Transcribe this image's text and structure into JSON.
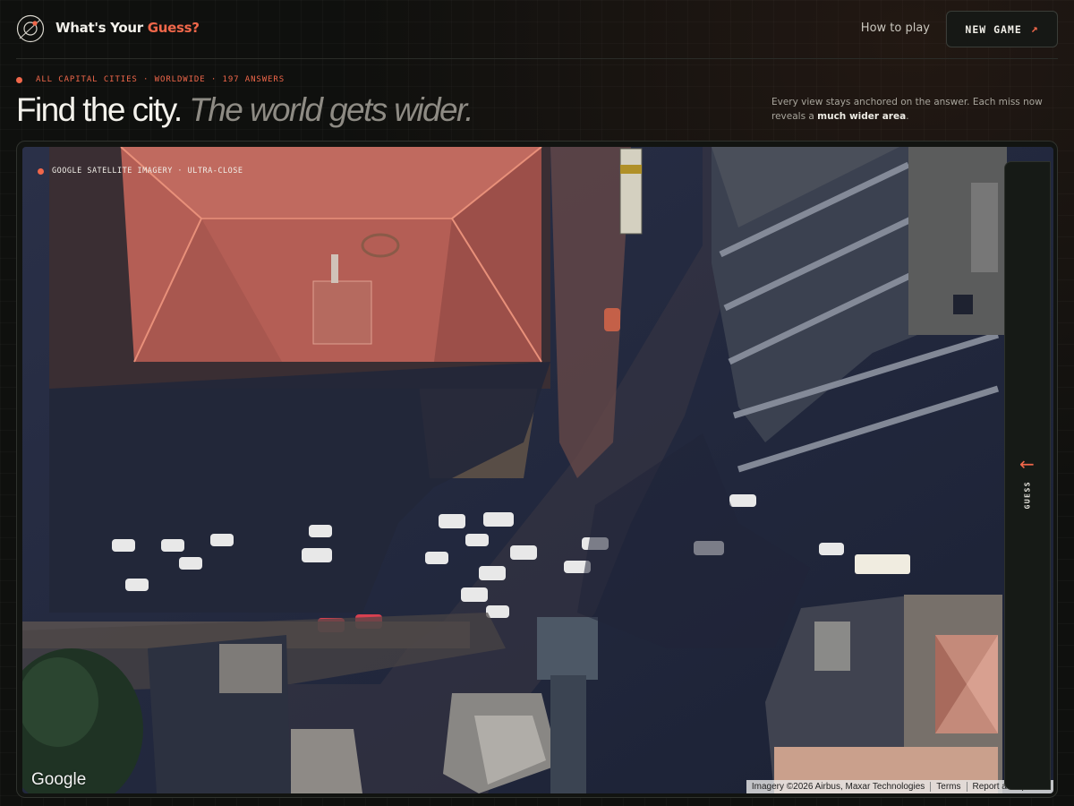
{
  "header": {
    "brand_prefix": "What's Your",
    "brand_accent": "Guess?",
    "how_to_play": "How to play",
    "new_game": "NEW GAME",
    "new_game_icon": "arrow-up-right-icon"
  },
  "intro": {
    "meta": [
      "ALL CAPITAL CITIES",
      "·",
      "WORLDWIDE",
      "·",
      "197 ANSWERS"
    ],
    "meta_text": "ALL CAPITAL CITIES · WORLDWIDE · 197 ANSWERS",
    "headline_plain": "Find the city.",
    "headline_italic": "The world gets wider.",
    "note_text": "Every view stays anchored on the answer. Each miss now reveals a",
    "note_bold": "much wider area",
    "note_end": "."
  },
  "map": {
    "imagery_tag": "GOOGLE SATELLITE IMAGERY · ULTRA-CLOSE",
    "google_logo": "Google",
    "attribution": "Imagery ©2026 Airbus, Maxar Technologies",
    "terms": "Terms",
    "report": "Report a map error"
  },
  "guess_panel": {
    "label": "GUESS",
    "icon": "arrow-left-icon"
  },
  "colors": {
    "accent": "#f0674a",
    "background": "#0f100e"
  }
}
